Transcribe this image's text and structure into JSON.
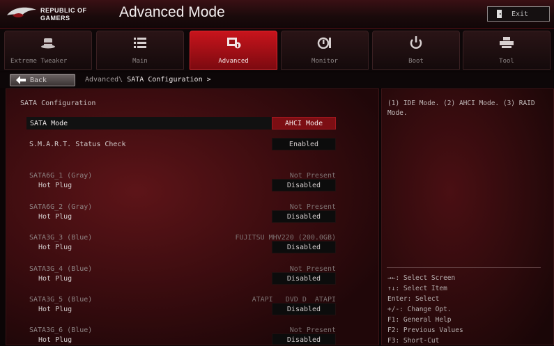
{
  "brand": {
    "line1": "REPUBLIC OF",
    "line2": "GAMERS"
  },
  "app_title": "Advanced Mode",
  "exit_label": "Exit",
  "tabs": [
    {
      "label": "Extreme Tweaker",
      "icon": "hat-icon",
      "active": false
    },
    {
      "label": "Main",
      "icon": "list-icon",
      "active": false
    },
    {
      "label": "Advanced",
      "icon": "chip-icon",
      "active": true
    },
    {
      "label": "Monitor",
      "icon": "gauge-icon",
      "active": false
    },
    {
      "label": "Boot",
      "icon": "power-icon",
      "active": false
    },
    {
      "label": "Tool",
      "icon": "printer-icon",
      "active": false
    }
  ],
  "back_label": "Back",
  "breadcrumb": {
    "parent": "Advanced\\",
    "current": "SATA Configuration >"
  },
  "section_title": "SATA Configuration",
  "settings": {
    "sata_mode": {
      "label": "SATA Mode",
      "value": "AHCI Mode"
    },
    "smart": {
      "label": "S.M.A.R.T. Status Check",
      "value": "Enabled"
    }
  },
  "ports": [
    {
      "name": "SATA6G_1 (Gray)",
      "status": "Not Present",
      "hotplug_label": "Hot Plug",
      "hotplug_value": "Disabled"
    },
    {
      "name": "SATA6G_2 (Gray)",
      "status": "Not Present",
      "hotplug_label": "Hot Plug",
      "hotplug_value": "Disabled"
    },
    {
      "name": "SATA3G_3 (Blue)",
      "status": "FUJITSU MHV220 (200.0GB)",
      "hotplug_label": "Hot Plug",
      "hotplug_value": "Disabled"
    },
    {
      "name": "SATA3G_4 (Blue)",
      "status": "Not Present",
      "hotplug_label": "Hot Plug",
      "hotplug_value": "Disabled"
    },
    {
      "name": "SATA3G_5 (Blue)",
      "status": "ATAPI   DVD D  ATAPI",
      "hotplug_label": "Hot Plug",
      "hotplug_value": "Disabled"
    },
    {
      "name": "SATA3G_6 (Blue)",
      "status": "Not Present",
      "hotplug_label": "Hot Plug",
      "hotplug_value": "Disabled"
    }
  ],
  "help": {
    "description": "(1) IDE Mode. (2) AHCI Mode. (3) RAID Mode.",
    "keys": [
      "→←: Select Screen",
      "↑↓: Select Item",
      "Enter: Select",
      "+/-: Change Opt.",
      "F1: General Help",
      "F2: Previous Values",
      "F3: Short-Cut"
    ]
  },
  "colors": {
    "accent_red": "#c8141c",
    "highlight_value_bg": "#7c0e13",
    "background": "#0b0506"
  }
}
